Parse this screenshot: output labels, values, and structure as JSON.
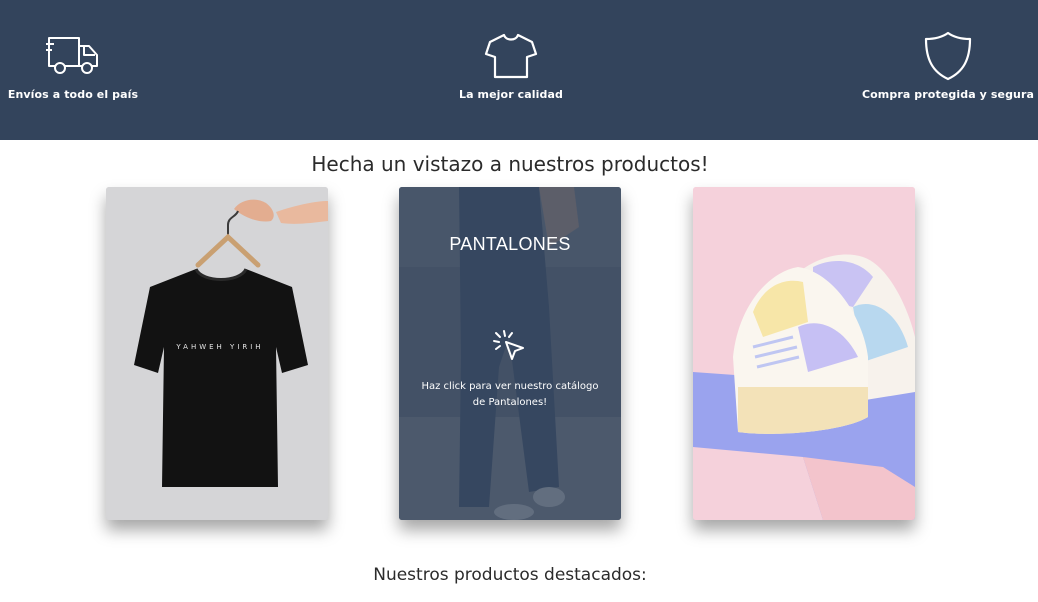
{
  "features": [
    {
      "label": "Envíos a todo el país",
      "icon": "truck-icon"
    },
    {
      "label": "La mejor calidad",
      "icon": "tshirt-icon"
    },
    {
      "label": "Compra protegida y segura",
      "icon": "shield-icon"
    }
  ],
  "products_section": {
    "title": "Hecha un vistazo a nuestros productos!",
    "cards": [
      {
        "name": "camisetas",
        "print_text": "YAHWEH YIRIH"
      },
      {
        "name": "pantalones",
        "title": "PANTALONES",
        "description": "Haz click para ver nuestro catálogo de Pantalones!",
        "icon": "click-cursor-icon"
      },
      {
        "name": "zapatillas"
      }
    ]
  },
  "featured_section": {
    "title": "Nuestros productos destacados:"
  },
  "colors": {
    "banner": "#33445c",
    "overlay": "rgba(51,68,92,0.72)"
  }
}
